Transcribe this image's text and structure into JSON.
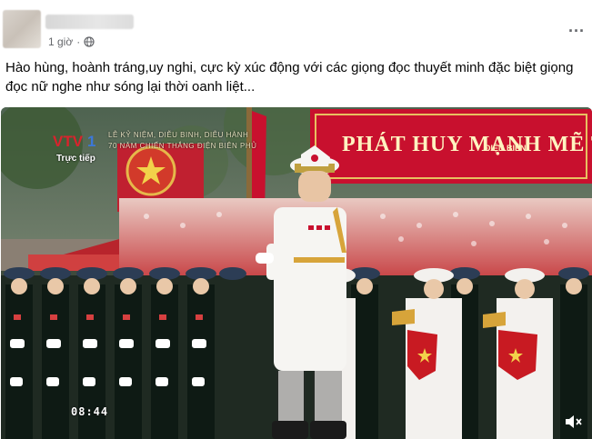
{
  "post": {
    "time_ago": "1 giờ",
    "caption": "Hào hùng, hoành tráng,uy nghi, cực kỳ xúc động với các giọng đọc thuyết minh đặc biệt giọng đọc nữ nghe như sóng lại thời oanh liệt..."
  },
  "video": {
    "channel_logo": "VTV1",
    "live_label": "Trực tiếp",
    "ticker_line1": "LỄ KỶ NIỆM, DIỄU BINH, DIỄU HÀNH",
    "ticker_line2": "70 NĂM CHIẾN THẮNG ĐIỆN BIÊN PHỦ",
    "banner_text": "PHÁT HUY MẠNH MẼ TINH",
    "banner_sub": "ĐIỆN BIÊN",
    "timestamp": "08:44"
  },
  "icons": {
    "privacy": "globe-icon",
    "menu": "more-options-icon",
    "sound": "mute-icon"
  },
  "colors": {
    "banner_red": "#c8102e",
    "text_secondary": "#65676b",
    "uniform_dark": "#1f2a22"
  }
}
